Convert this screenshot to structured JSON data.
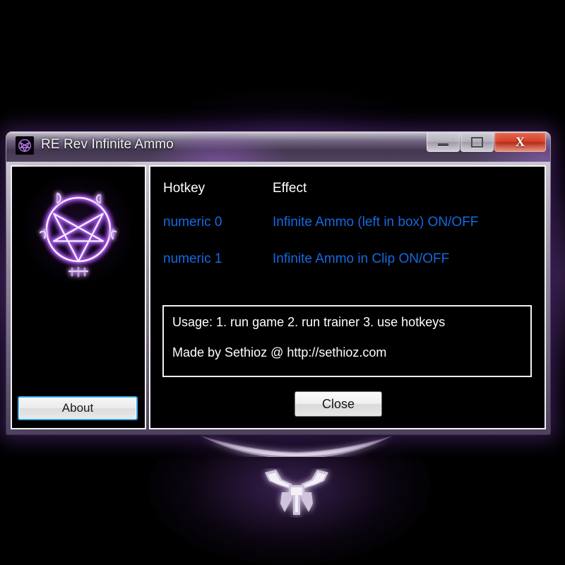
{
  "window": {
    "title": "RE Rev Infinite Ammo",
    "icon": "pentagram-icon",
    "controls": {
      "minimize": "minimize-icon",
      "maximize": "maximize-icon",
      "close": "X"
    }
  },
  "left_panel": {
    "logo": "pentagram-logo",
    "about_label": "About"
  },
  "main_panel": {
    "table": {
      "headers": [
        "Hotkey",
        "Effect"
      ],
      "rows": [
        {
          "hotkey": "numeric 0",
          "effect": "Infinite Ammo (left in box) ON/OFF"
        },
        {
          "hotkey": "numeric 1",
          "effect": "Infinite Ammo in Clip ON/OFF"
        }
      ]
    },
    "usage_box": {
      "lines": [
        "Usage: 1. run game    2. run trainer    3. use hotkeys",
        "Made by Sethioz @ http://sethioz.com"
      ]
    },
    "close_label": "Close"
  },
  "colors": {
    "hotkey_text": "#1569e0",
    "header_text": "#ffffff",
    "panel_background": "#000000",
    "accent_purple": "#7b3cb0",
    "close_button_red": "#d4412a",
    "focus_ring_blue": "#3daae8"
  },
  "desktop": {
    "emblem": "winged-trident-emblem"
  }
}
